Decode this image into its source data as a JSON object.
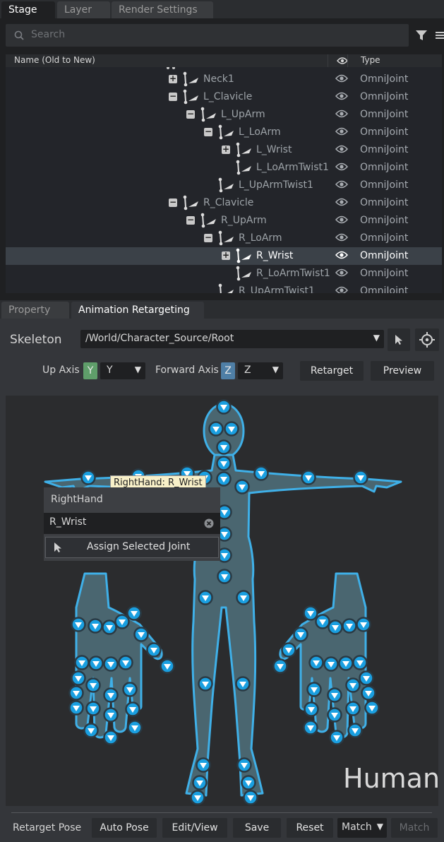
{
  "stage_tabs": [
    {
      "label": "Stage",
      "active": true
    },
    {
      "label": "Layer",
      "active": false
    },
    {
      "label": "Render Settings",
      "active": false
    }
  ],
  "search": {
    "placeholder": "Search"
  },
  "columns": {
    "name": "Name (Old to New)",
    "type": "Type"
  },
  "tree_rows": [
    {
      "label": "Neck1",
      "type": "OmniJoint",
      "expander": "+",
      "selected": false
    },
    {
      "label": "L_Clavicle",
      "type": "OmniJoint",
      "expander": "-",
      "selected": false
    },
    {
      "label": "L_UpArm",
      "type": "OmniJoint",
      "expander": "-",
      "selected": false
    },
    {
      "label": "L_LoArm",
      "type": "OmniJoint",
      "expander": "-",
      "selected": false
    },
    {
      "label": "L_Wrist",
      "type": "OmniJoint",
      "expander": "+",
      "selected": false
    },
    {
      "label": "L_LoArmTwist1",
      "type": "OmniJoint",
      "expander": "",
      "selected": false
    },
    {
      "label": "L_UpArmTwist1",
      "type": "OmniJoint",
      "expander": "",
      "selected": false
    },
    {
      "label": "R_Clavicle",
      "type": "OmniJoint",
      "expander": "-",
      "selected": false
    },
    {
      "label": "R_UpArm",
      "type": "OmniJoint",
      "expander": "-",
      "selected": false
    },
    {
      "label": "R_LoArm",
      "type": "OmniJoint",
      "expander": "-",
      "selected": false
    },
    {
      "label": "R_Wrist",
      "type": "OmniJoint",
      "expander": "+",
      "selected": true
    },
    {
      "label": "R_LoArmTwist1",
      "type": "OmniJoint",
      "expander": "",
      "selected": false
    },
    {
      "label": "R_UpArmTwist1",
      "type": "OmniJoint",
      "expander": "",
      "selected": false
    }
  ],
  "panel_tabs": [
    {
      "label": "Property",
      "active": false
    },
    {
      "label": "Animation Retargeting",
      "active": true
    }
  ],
  "skeleton": {
    "label": "Skeleton",
    "path": "/World/Character_Source/Root"
  },
  "axes": {
    "up_label": "Up Axis",
    "up_badge": "Y",
    "up_value": "Y",
    "forward_label": "Forward Axis",
    "forward_badge": "Z",
    "forward_value": "Z"
  },
  "actions": {
    "retarget": "Retarget",
    "preview": "Preview"
  },
  "tooltip": "RightHand: R_Wrist",
  "popup": {
    "title": "RightHand",
    "value": "R_Wrist",
    "assign": "Assign Selected Joint"
  },
  "figure_label": "Human",
  "bottom": {
    "retarget_pose": "Retarget Pose",
    "auto_pose": "Auto Pose",
    "edit_view": "Edit/View",
    "save": "Save",
    "reset": "Reset",
    "match_select": "Match",
    "match_button": "Match"
  },
  "colors": {
    "accent": "#3fb0e8",
    "body_fill": "#4a6670",
    "selected_row": "#3b4148",
    "y_badge": "#5f9e6a",
    "z_badge": "#4f7fa6"
  }
}
